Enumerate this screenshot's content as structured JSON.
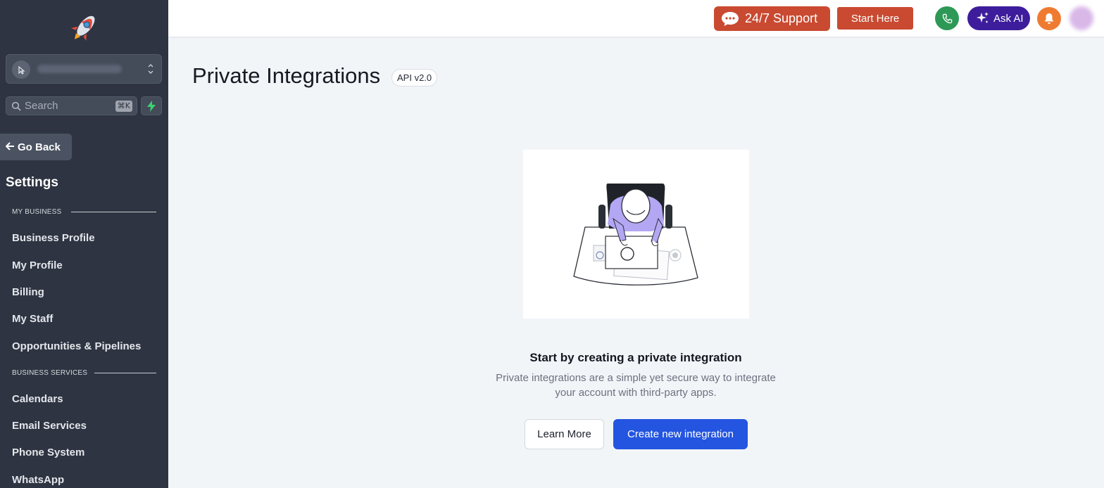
{
  "sidebar": {
    "search_placeholder": "Search",
    "search_shortcut": "⌘K",
    "go_back_label": "Go Back",
    "settings_title": "Settings",
    "sections": [
      {
        "label": "MY BUSINESS",
        "items": [
          "Business Profile",
          "My Profile",
          "Billing",
          "My Staff",
          "Opportunities & Pipelines"
        ]
      },
      {
        "label": "BUSINESS SERVICES",
        "items": [
          "Calendars",
          "Email Services",
          "Phone System",
          "WhatsApp"
        ]
      }
    ]
  },
  "topbar": {
    "support_label": "24/7 Support",
    "start_label": "Start Here",
    "askai_label": "Ask AI"
  },
  "main": {
    "title": "Private Integrations",
    "api_badge": "API v2.0",
    "empty_title": "Start by creating a private integration",
    "empty_desc": "Private integrations are a simple yet secure way to integrate your account with third-party apps.",
    "learn_more_label": "Learn More",
    "create_label": "Create new integration"
  },
  "colors": {
    "sidebar_bg": "#2e3441",
    "support_orange": "#c94a31",
    "phone_green": "#2e9957",
    "askai_purple": "#3d1d9c",
    "bell_orange": "#ef7b31",
    "primary_blue": "#2455e0"
  }
}
